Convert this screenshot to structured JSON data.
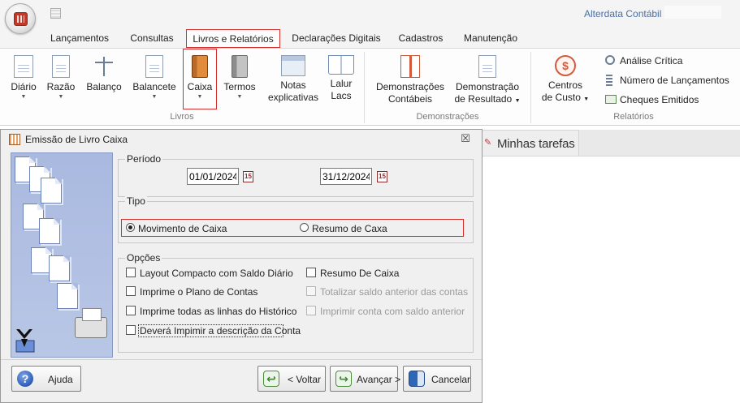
{
  "app": {
    "title": "Alterdata Contábil"
  },
  "tabs": [
    {
      "label": "Lançamentos"
    },
    {
      "label": "Consultas"
    },
    {
      "label": "Livros e Relatórios"
    },
    {
      "label": "Declarações Digitais"
    },
    {
      "label": "Cadastros"
    },
    {
      "label": "Manutenção"
    }
  ],
  "ribbon": {
    "livros": {
      "group_label": "Livros",
      "buttons": [
        {
          "label": "Diário"
        },
        {
          "label": "Razão"
        },
        {
          "label": "Balanço"
        },
        {
          "label": "Balancete"
        },
        {
          "label": "Caixa"
        },
        {
          "label": "Termos"
        },
        {
          "label1": "Notas",
          "label2": "explicativas"
        },
        {
          "label1": "Lalur",
          "label2": "Lacs"
        }
      ]
    },
    "demonstracoes": {
      "group_label": "Demonstrações",
      "buttons": [
        {
          "label1": "Demonstrações",
          "label2": "Contábeis"
        },
        {
          "label1": "Demonstração",
          "label2": "de Resultado"
        }
      ]
    },
    "relatorios": {
      "group_label": "Relatórios",
      "centros": {
        "label1": "Centros",
        "label2": "de Custo"
      },
      "small": [
        {
          "label": "Análise Crítica"
        },
        {
          "label": "Número de Lançamentos"
        },
        {
          "label": "Cheques Emitidos"
        }
      ]
    }
  },
  "tasks": {
    "label": "Minhas tarefas"
  },
  "dialog": {
    "title": "Emissão de Livro Caixa",
    "close": "☒",
    "periodo": {
      "legend": "Período",
      "start": "01/01/2024",
      "end": "31/12/2024"
    },
    "tipo": {
      "legend": "Tipo",
      "options": [
        {
          "label": "Movimento de Caixa",
          "selected": true
        },
        {
          "label": "Resumo de Caxa",
          "selected": false
        }
      ]
    },
    "opcoes": {
      "legend": "Opções",
      "left": [
        {
          "label": "Layout Compacto com Saldo Diário"
        },
        {
          "label": "Imprime o Plano de Contas"
        },
        {
          "label": "Imprime todas as linhas do Histórico"
        },
        {
          "label": "Deverá Impimir a descrição da Conta"
        }
      ],
      "right": [
        {
          "label": "Resumo De Caixa",
          "enabled": true
        },
        {
          "label": "Totalizar saldo anterior das contas",
          "enabled": false
        },
        {
          "label": "Imprimir conta com saldo anterior",
          "enabled": false
        }
      ]
    },
    "buttons": {
      "help": "Ajuda",
      "back": "< Voltar",
      "next": "Avançar >",
      "cancel": "Cancelar"
    }
  },
  "colors": {
    "accent_red": "#d52c2c",
    "title_blue": "#4a6fa5"
  }
}
